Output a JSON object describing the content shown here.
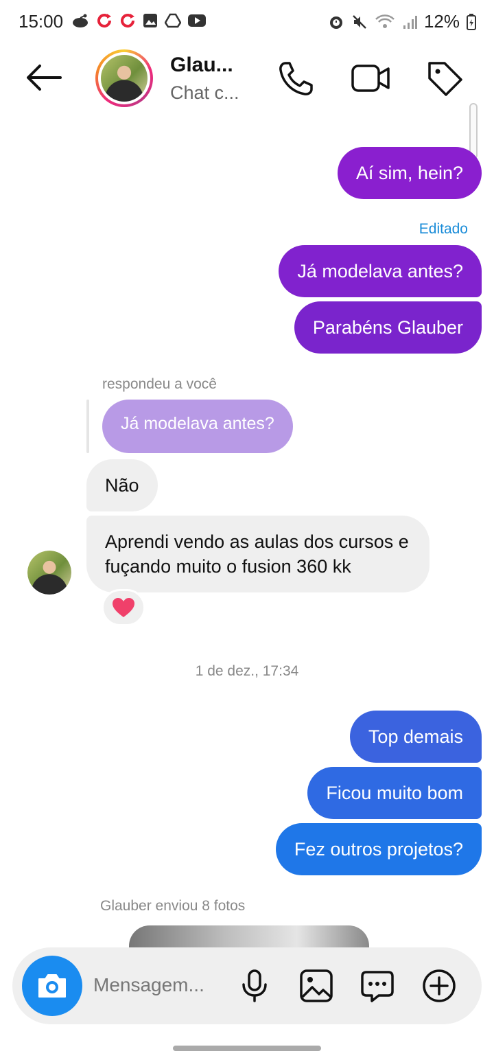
{
  "status_bar": {
    "time": "15:00",
    "battery": "12%"
  },
  "header": {
    "name": "Glau...",
    "subtitle": "Chat c..."
  },
  "messages": {
    "m1": "Aí sim, hein?",
    "edited_label": "Editado",
    "m2": "Já modelava antes?",
    "m3": "Parabéns Glauber",
    "reply_meta": "respondeu a você",
    "reply_quote": "Já modelava antes?",
    "m4": "Não",
    "m5_line1": "Aprendi vendo as aulas dos cursos e",
    "m5_line2": "fuçando muito o fusion 360 kk",
    "reaction": "♥",
    "timestamp": "1 de dez., 17:34",
    "m6": "Top demais",
    "m7": "Ficou muito bom",
    "m8": "Fez outros projetos?",
    "photos_meta": "Glauber enviou 8 fotos"
  },
  "composer": {
    "placeholder": "Mensagem..."
  },
  "colors": {
    "purple_1": "#8a1fcf",
    "purple_2": "#7a24cc",
    "blue_1": "#3b63df",
    "blue_2": "#2f6ae3",
    "blue_3": "#1f77e8",
    "camera": "#1a8cf0"
  }
}
